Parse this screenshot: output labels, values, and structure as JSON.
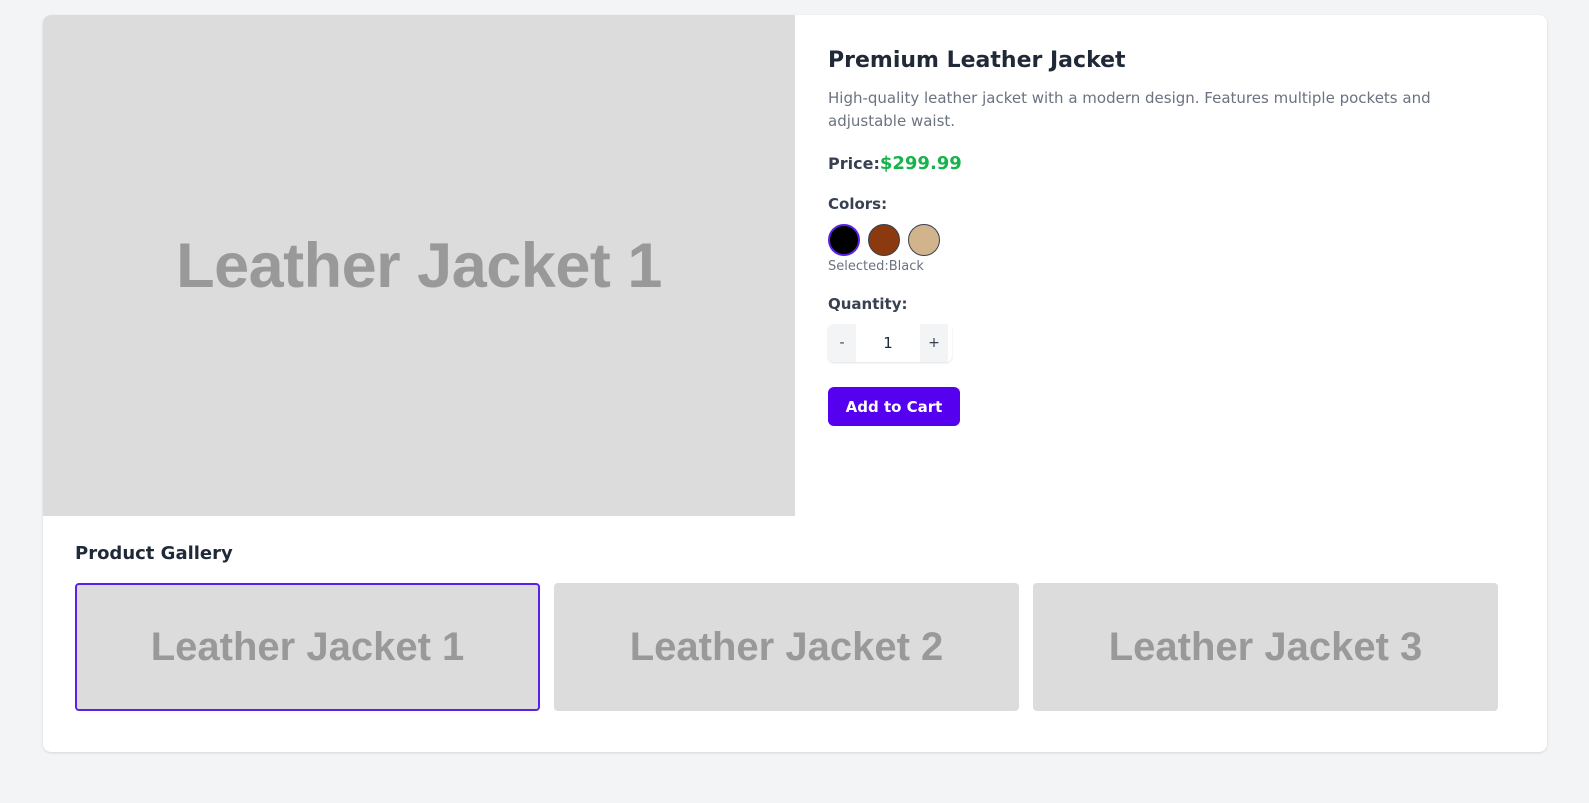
{
  "product": {
    "title": "Premium Leather Jacket",
    "description": "High-quality leather jacket with a modern design. Features multiple pockets and adjustable waist.",
    "price_label": "Price:",
    "price": "$299.99",
    "main_image_label": "Leather Jacket 1"
  },
  "colors": {
    "label": "Colors:",
    "options": [
      {
        "name": "Black",
        "hex": "#000000"
      },
      {
        "name": "Brown",
        "hex": "#8b3a0f"
      },
      {
        "name": "Tan",
        "hex": "#d2b48c"
      }
    ],
    "selected_prefix": "Selected:",
    "selected": "Black"
  },
  "quantity": {
    "label": "Quantity:",
    "decrement": "-",
    "value": "1",
    "increment": "+"
  },
  "cart": {
    "add_label": "Add to Cart"
  },
  "gallery": {
    "title": "Product Gallery",
    "items": [
      {
        "label": "Leather Jacket 1"
      },
      {
        "label": "Leather Jacket 2"
      },
      {
        "label": "Leather Jacket 3"
      }
    ]
  },
  "theme": {
    "accent": "#5500ee",
    "price_color": "#16b34a"
  }
}
